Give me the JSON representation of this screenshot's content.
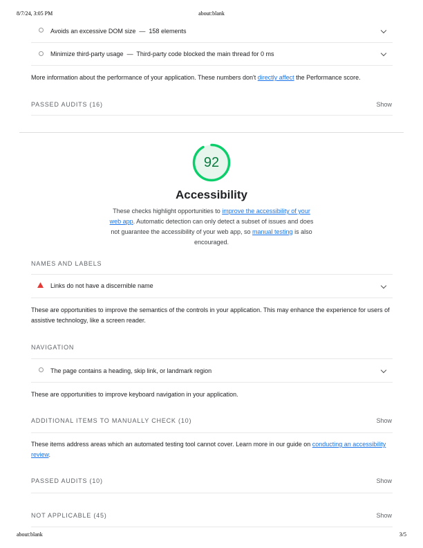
{
  "print_header": {
    "datetime": "8/7/24, 3:05 PM",
    "title": "about:blank"
  },
  "print_footer": {
    "url": "about:blank",
    "page": "3/5"
  },
  "perf_audits": [
    {
      "title": "Avoids an excessive DOM size",
      "sep": "—",
      "detail": "158 elements"
    },
    {
      "title": "Minimize third-party usage",
      "sep": "—",
      "detail": "Third-party code blocked the main thread for 0 ms"
    }
  ],
  "perf_note": {
    "before": "More information about the performance of your application. These numbers don't ",
    "link": "directly affect",
    "after": " the Performance score."
  },
  "perf_passed": {
    "label": "PASSED AUDITS (16)",
    "show": "Show"
  },
  "accessibility": {
    "score": "92",
    "score_value": 92,
    "title": "Accessibility",
    "desc_1": "These checks highlight opportunities to ",
    "desc_link_1": "improve the accessibility of your web app",
    "desc_2": ". Automatic detection can only detect a subset of issues and does not guarantee the accessibility of your web app, so ",
    "desc_link_2": "manual testing",
    "desc_3": " is also encouraged."
  },
  "names_labels": {
    "title": "NAMES AND LABELS",
    "audit": "Links do not have a discernible name",
    "note": "These are opportunities to improve the semantics of the controls in your application. This may enhance the experience for users of assistive technology, like a screen reader."
  },
  "navigation": {
    "title": "NAVIGATION",
    "audit": "The page contains a heading, skip link, or landmark region",
    "note": "These are opportunities to improve keyboard navigation in your application."
  },
  "manual": {
    "label": "ADDITIONAL ITEMS TO MANUALLY CHECK (10)",
    "show": "Show",
    "note_before": "These items address areas which an automated testing tool cannot cover. Learn more in our guide on ",
    "note_link": "conducting an accessibility review",
    "note_after": "."
  },
  "a11y_passed": {
    "label": "PASSED AUDITS (10)",
    "show": "Show"
  },
  "not_applicable": {
    "label": "NOT APPLICABLE (45)",
    "show": "Show"
  },
  "colors": {
    "score_ring": "#0cce6b",
    "score_text": "#0a7a3e",
    "fail": "#e53935",
    "link": "#1a73e8"
  }
}
